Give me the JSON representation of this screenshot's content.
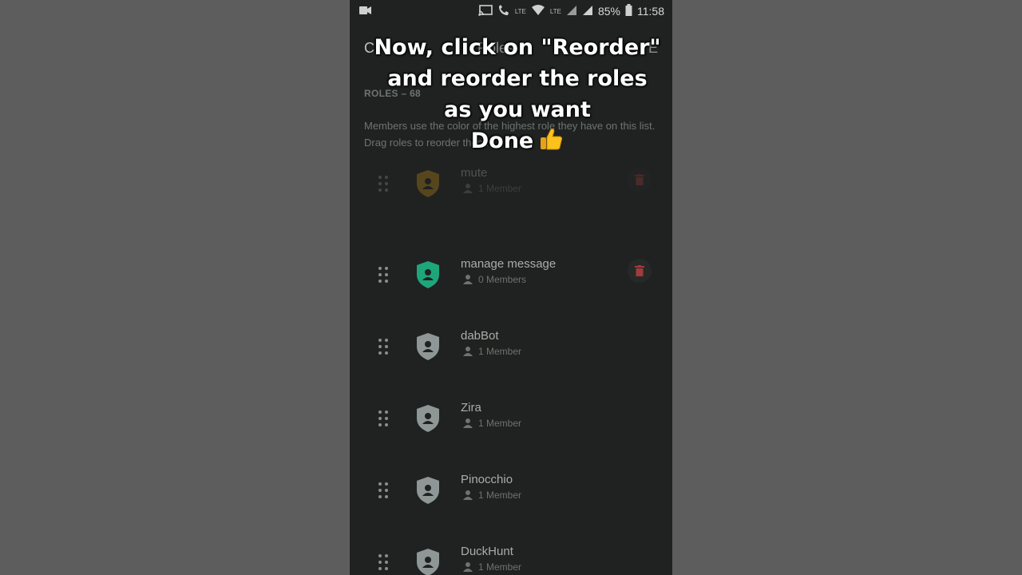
{
  "statusbar": {
    "lte_label": "LTE",
    "lte2_label": "LTE",
    "battery": "85%",
    "time": "11:58"
  },
  "appbar": {
    "back_label": "C",
    "title": "Roles",
    "save_label": "E"
  },
  "section": {
    "header": "ROLES – 68",
    "description": "Members use the color of the highest role they have on this list. Drag roles to reorder them."
  },
  "roles": [
    {
      "name": "mute",
      "count": "1 Member",
      "color": "#c08a1a",
      "deletable": true,
      "faded": true
    },
    {
      "name": "manage message",
      "count": "0 Members",
      "color": "#1fa57a",
      "deletable": true,
      "faded": false
    },
    {
      "name": "dabBot",
      "count": "1 Member",
      "color": "#8e9795",
      "deletable": false,
      "faded": false
    },
    {
      "name": "Zira",
      "count": "1 Member",
      "color": "#8e9795",
      "deletable": false,
      "faded": false
    },
    {
      "name": "Pinocchio",
      "count": "1 Member",
      "color": "#8e9795",
      "deletable": false,
      "faded": false
    },
    {
      "name": "DuckHunt",
      "count": "1 Member",
      "color": "#8e9795",
      "deletable": false,
      "faded": false
    }
  ],
  "overlay": {
    "lines": [
      "Now, click on \"Reorder\"",
      "and reorder the roles",
      "as you want",
      "Done"
    ],
    "emoji_icon": "thumbs-up-icon"
  },
  "colors": {
    "background": "#1f2220",
    "danger": "#a33b3b"
  }
}
